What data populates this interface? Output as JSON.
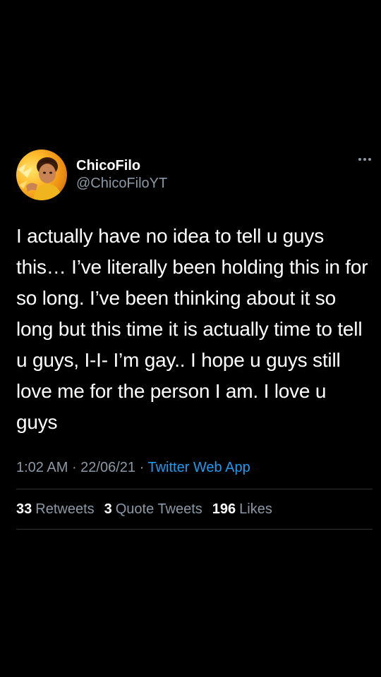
{
  "tweet": {
    "author": {
      "display_name": "ChicoFilo",
      "handle": "@ChicoFiloYT",
      "avatar_icon": "profile-avatar"
    },
    "more_icon": "more-horizontal-icon",
    "text": "I actually have no idea to tell u guys this… I’ve literally been holding this in for so long. I’ve been thinking about it so long but this time it is actually time to tell u guys, I-I- I’m gay.. I hope u guys still love me for the person I am. I love u guys",
    "time": "1:02 AM",
    "separator": "·",
    "date": "22/06/21",
    "source": "Twitter Web App",
    "stats": {
      "retweets_count": "33",
      "retweets_label": "Retweets",
      "quotes_count": "3",
      "quotes_label": "Quote Tweets",
      "likes_count": "196",
      "likes_label": "Likes"
    }
  },
  "colors": {
    "background": "#000000",
    "text": "#ffffff",
    "secondary": "#8b98a5",
    "link": "#1d9bf0",
    "divider": "#2f3336"
  }
}
